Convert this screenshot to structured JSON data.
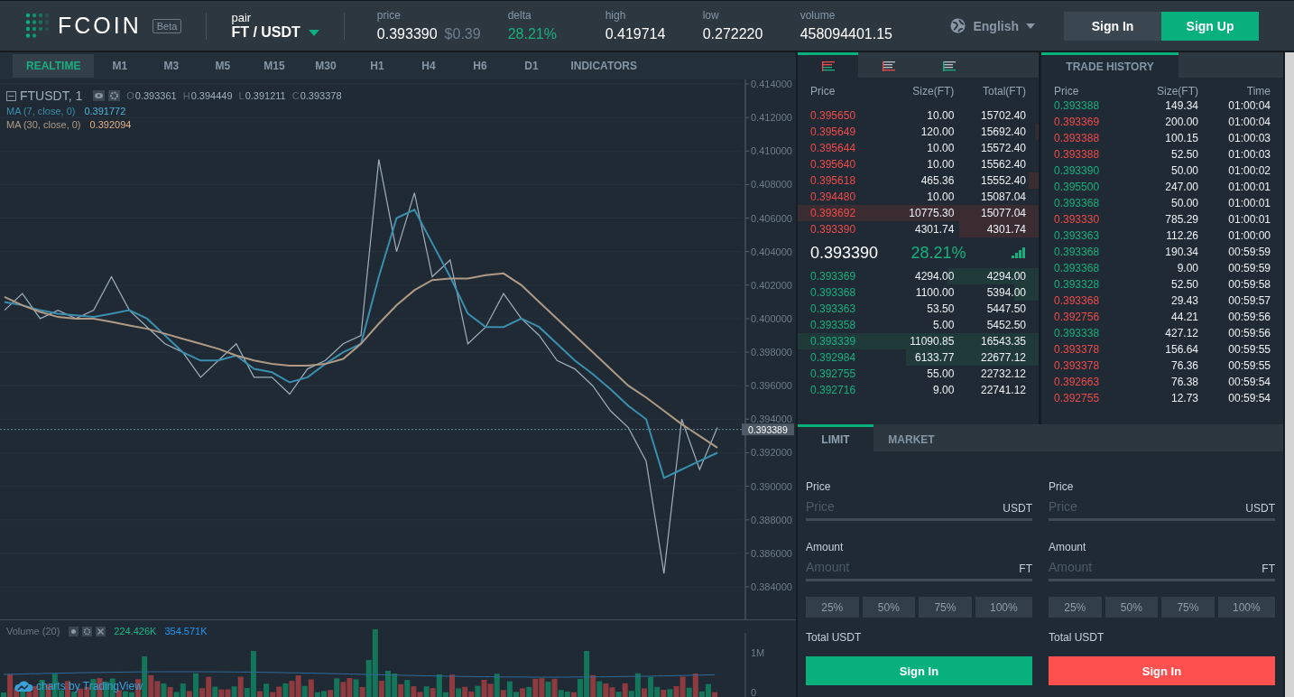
{
  "header": {
    "logo_text": "FCOIN",
    "badge": "Beta",
    "pair_label": "pair",
    "pair": "FT / USDT",
    "stats": [
      {
        "label": "price",
        "value": "0.393390",
        "secondary": "$0.39",
        "kind": "plain"
      },
      {
        "label": "delta",
        "value": "28.21%",
        "kind": "up"
      },
      {
        "label": "high",
        "value": "0.419714",
        "kind": "plain"
      },
      {
        "label": "low",
        "value": "0.272220",
        "kind": "plain"
      },
      {
        "label": "volume",
        "value": "458094401.15",
        "kind": "plain"
      }
    ],
    "language": "English",
    "buttons": [
      {
        "label": "Sign In",
        "kind": "plain"
      },
      {
        "label": "Sign Up",
        "kind": "primary"
      }
    ]
  },
  "chart": {
    "intervals": [
      {
        "label": "REALTIME",
        "selected": true
      },
      {
        "label": "M1",
        "selected": false
      },
      {
        "label": "M3",
        "selected": false
      },
      {
        "label": "M5",
        "selected": false
      },
      {
        "label": "M15",
        "selected": false
      },
      {
        "label": "M30",
        "selected": false
      },
      {
        "label": "H1",
        "selected": false
      },
      {
        "label": "H4",
        "selected": false
      },
      {
        "label": "H6",
        "selected": false
      },
      {
        "label": "D1",
        "selected": false
      },
      {
        "label": "INDICATORS",
        "selected": false
      }
    ],
    "legend": {
      "ohlc": [
        {
          "key": "O",
          "value": "0.393361"
        },
        {
          "key": "H",
          "value": "0.394449"
        },
        {
          "key": "L",
          "value": "0.391211"
        },
        {
          "key": "C",
          "value": "0.393378"
        }
      ],
      "ma": [
        {
          "value": "0.391772",
          "color": "#4fb5d8"
        },
        {
          "value": "0.392094",
          "color": "#e0b088"
        }
      ]
    },
    "chart_data": {
      "type": "line",
      "ylim": [
        0.38206,
        0.41427
      ],
      "grid": true,
      "ref_lines": [
        {
          "axis": "y",
          "value": 0.393389,
          "label": "0.393389"
        }
      ],
      "yticks": [
        {
          "value": 0.384,
          "label": "0.384000"
        },
        {
          "value": 0.386,
          "label": "0.386000"
        },
        {
          "value": 0.388,
          "label": "0.388000"
        },
        {
          "value": 0.39,
          "label": "0.390000"
        },
        {
          "value": 0.392,
          "label": "0.392000"
        },
        {
          "value": 0.394,
          "label": "0.394000"
        },
        {
          "value": 0.396,
          "label": "0.396000"
        },
        {
          "value": 0.398,
          "label": "0.398000"
        },
        {
          "value": 0.4,
          "label": "0.400000"
        },
        {
          "value": 0.402,
          "label": "0.402000"
        },
        {
          "value": 0.404,
          "label": "0.404000"
        },
        {
          "value": 0.406,
          "label": "0.406000"
        },
        {
          "value": 0.408,
          "label": "0.408000"
        },
        {
          "value": 0.41,
          "label": "0.410000"
        },
        {
          "value": 0.412,
          "label": "0.412000"
        },
        {
          "value": 0.414,
          "label": "0.414000"
        }
      ],
      "series": [
        {
          "name": "FTUSDT, 1",
          "color": "#9fb0bd",
          "values": [
            0.4005,
            0.4015,
            0.4,
            0.4005,
            0.4,
            0.4005,
            0.4025,
            0.4005,
            0.3995,
            0.3985,
            0.398,
            0.3965,
            0.3975,
            0.3985,
            0.3965,
            0.3965,
            0.3955,
            0.397,
            0.3975,
            0.3985,
            0.399,
            0.4095,
            0.404,
            0.4075,
            0.4025,
            0.4035,
            0.3985,
            0.3995,
            0.4015,
            0.4,
            0.399,
            0.3975,
            0.397,
            0.396,
            0.3945,
            0.3935,
            0.3915,
            0.3848,
            0.394,
            0.391,
            0.3935
          ]
        },
        {
          "name": "MA (7, close, 0)",
          "color": "#3a8fae",
          "values": [
            0.401,
            0.4008,
            0.4005,
            0.4003,
            0.4002,
            0.4001,
            0.4003,
            0.4005,
            0.4,
            0.399,
            0.398,
            0.3975,
            0.3975,
            0.3978,
            0.397,
            0.3968,
            0.3962,
            0.3965,
            0.3973,
            0.398,
            0.3985,
            0.4025,
            0.406,
            0.4065,
            0.4045,
            0.4025,
            0.4003,
            0.3995,
            0.3995,
            0.4,
            0.3995,
            0.3985,
            0.3975,
            0.3967,
            0.3958,
            0.3948,
            0.394,
            0.3905,
            0.391,
            0.3915,
            0.392
          ]
        },
        {
          "name": "MA (30, close, 0)",
          "color": "#b09a85",
          "values": [
            0.4013,
            0.4008,
            0.4004,
            0.4001,
            0.4,
            0.4,
            0.3998,
            0.3996,
            0.3994,
            0.3991,
            0.3988,
            0.3985,
            0.3982,
            0.3978,
            0.3975,
            0.3973,
            0.3972,
            0.3972,
            0.3973,
            0.3976,
            0.3985,
            0.3997,
            0.4008,
            0.4017,
            0.4023,
            0.4024,
            0.4024,
            0.4026,
            0.4027,
            0.402,
            0.401,
            0.4,
            0.399,
            0.398,
            0.397,
            0.396,
            0.3953,
            0.3945,
            0.3937,
            0.393,
            0.3923
          ]
        }
      ]
    },
    "volume": {
      "label": "Volume (20)",
      "values": [
        {
          "text": "224.426K",
          "color": "#17b884"
        },
        {
          "text": "354.571K",
          "color": "#2196f3"
        }
      ],
      "axis": [
        "1M",
        "0"
      ]
    },
    "attribution": "charts by TradingView"
  },
  "order_book": {
    "tabs": [
      {
        "kind": "both",
        "selected": true
      },
      {
        "kind": "asks",
        "selected": false
      },
      {
        "kind": "bids",
        "selected": false
      }
    ],
    "columns": [
      "Price",
      "Size(FT)",
      "Total(FT)"
    ],
    "asks": [
      {
        "price": "0.395650",
        "size": "10.00",
        "total": "15702.40"
      },
      {
        "price": "0.395649",
        "size": "120.00",
        "total": "15692.40",
        "level": 0.01
      },
      {
        "price": "0.395644",
        "size": "10.00",
        "total": "15572.40"
      },
      {
        "price": "0.395640",
        "size": "10.00",
        "total": "15562.40"
      },
      {
        "price": "0.395618",
        "size": "465.36",
        "total": "15552.40",
        "level": 0.04
      },
      {
        "price": "0.394480",
        "size": "10.00",
        "total": "15087.04"
      },
      {
        "price": "0.393692",
        "size": "10775.30",
        "total": "15077.04",
        "level": 1
      },
      {
        "price": "0.393390",
        "size": "4301.74",
        "total": "4301.74",
        "level": 0.33
      }
    ],
    "last": {
      "price": "0.393390",
      "change": "28.21%"
    },
    "bids": [
      {
        "price": "0.393369",
        "size": "4294.00",
        "total": "4294.00",
        "level": 0.38
      },
      {
        "price": "0.393368",
        "size": "1100.00",
        "total": "5394.00",
        "level": 0.1
      },
      {
        "price": "0.393363",
        "size": "53.50",
        "total": "5447.50"
      },
      {
        "price": "0.393358",
        "size": "5.00",
        "total": "5452.50"
      },
      {
        "price": "0.393339",
        "size": "11090.85",
        "total": "16543.35",
        "level": 1
      },
      {
        "price": "0.392984",
        "size": "6133.77",
        "total": "22677.12",
        "level": 0.55
      },
      {
        "price": "0.392755",
        "size": "55.00",
        "total": "22732.12"
      },
      {
        "price": "0.392716",
        "size": "9.00",
        "total": "22741.12"
      }
    ]
  },
  "trade_history": {
    "tab": {
      "label": "TRADE HISTORY",
      "selected": true
    },
    "columns": [
      "Price",
      "Size(FT)",
      "Time"
    ],
    "rows": [
      {
        "price": "0.393388",
        "size": "149.34",
        "time": "01:00:04",
        "kind": "buy"
      },
      {
        "price": "0.393369",
        "size": "200.00",
        "time": "01:00:04",
        "kind": "sell"
      },
      {
        "price": "0.393388",
        "size": "100.15",
        "time": "01:00:03",
        "kind": "sell"
      },
      {
        "price": "0.393388",
        "size": "52.50",
        "time": "01:00:03",
        "kind": "sell"
      },
      {
        "price": "0.393390",
        "size": "50.00",
        "time": "01:00:02",
        "kind": "buy"
      },
      {
        "price": "0.395500",
        "size": "247.00",
        "time": "01:00:01",
        "kind": "buy"
      },
      {
        "price": "0.393368",
        "size": "50.00",
        "time": "01:00:01",
        "kind": "buy"
      },
      {
        "price": "0.393330",
        "size": "785.29",
        "time": "01:00:01",
        "kind": "sell"
      },
      {
        "price": "0.393363",
        "size": "112.26",
        "time": "01:00:00",
        "kind": "buy"
      },
      {
        "price": "0.393368",
        "size": "190.34",
        "time": "00:59:59",
        "kind": "buy"
      },
      {
        "price": "0.393368",
        "size": "9.00",
        "time": "00:59:59",
        "kind": "buy"
      },
      {
        "price": "0.393328",
        "size": "52.50",
        "time": "00:59:58",
        "kind": "buy"
      },
      {
        "price": "0.393368",
        "size": "29.43",
        "time": "00:59:57",
        "kind": "sell"
      },
      {
        "price": "0.392756",
        "size": "44.21",
        "time": "00:59:56",
        "kind": "sell"
      },
      {
        "price": "0.393338",
        "size": "427.12",
        "time": "00:59:56",
        "kind": "buy"
      },
      {
        "price": "0.393378",
        "size": "156.64",
        "time": "00:59:55",
        "kind": "sell"
      },
      {
        "price": "0.393378",
        "size": "76.36",
        "time": "00:59:55",
        "kind": "sell"
      },
      {
        "price": "0.392663",
        "size": "76.38",
        "time": "00:59:54",
        "kind": "sell"
      },
      {
        "price": "0.392755",
        "size": "12.73",
        "time": "00:59:54",
        "kind": "sell"
      }
    ]
  },
  "order_form": {
    "tabs": [
      {
        "label": "LIMIT",
        "selected": true
      },
      {
        "label": "MARKET",
        "selected": false
      }
    ],
    "panels": [
      {
        "kind": "buy",
        "fields": [
          {
            "label": "Price",
            "placeholder": "Price",
            "unit": "USDT"
          },
          {
            "label": "Amount",
            "placeholder": "Amount",
            "unit": "FT"
          }
        ],
        "percentages": [
          "25%",
          "50%",
          "75%",
          "100%"
        ],
        "total_label": "Total USDT",
        "button": "Sign In"
      },
      {
        "kind": "sell",
        "fields": [
          {
            "label": "Price",
            "placeholder": "Price",
            "unit": "USDT"
          },
          {
            "label": "Amount",
            "placeholder": "Amount",
            "unit": "FT"
          }
        ],
        "percentages": [
          "25%",
          "50%",
          "75%",
          "100%"
        ],
        "total_label": "Total USDT",
        "button": "Sign In"
      }
    ]
  }
}
